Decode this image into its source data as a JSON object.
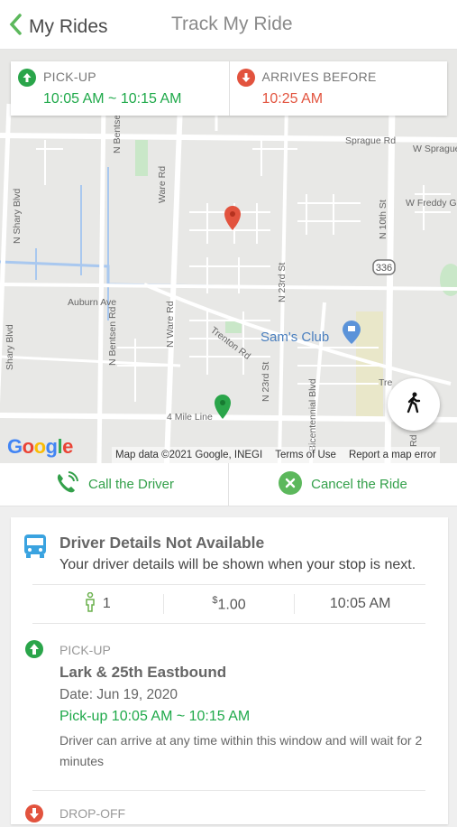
{
  "header": {
    "back_label": "My Rides",
    "title": "Track My Ride"
  },
  "map": {
    "pickup_label": "PICK-UP",
    "pickup_time": "10:05 AM ~ 10:15 AM",
    "arrives_label": "ARRIVES BEFORE",
    "arrives_time": "10:25 AM",
    "google": "Google",
    "attribution": {
      "map_data": "Map data ©2021 Google, INEGI",
      "terms": "Terms of Use",
      "report": "Report a map error"
    },
    "labels": {
      "sprague_rd": "Sprague Rd",
      "w_sprague": "W Sprague",
      "w_freddy": "W Freddy Go",
      "auburn": "Auburn Ave",
      "n_shary": "N Shary Blvd",
      "n_bentsen": "N Bentsen Rd",
      "ware_rd": "Ware Rd",
      "n_ware": "N Ware Rd",
      "trenton": "Trenton Rd",
      "n_23rd": "N 23rd St",
      "n_10th": "N 10th St",
      "four_mile": "4 Mile Line",
      "bicentennial": "Bicentennial Blvd",
      "sams_club": "Sam's Club",
      "hwy336": "336",
      "shary_blvd": "Shary Blvd",
      "tre": "Tre",
      "rd": "Rd"
    }
  },
  "actions": {
    "call": "Call the Driver",
    "cancel": "Cancel the Ride"
  },
  "driver": {
    "title": "Driver Details Not Available",
    "subtitle": "Your driver details will be shown when your stop is next.",
    "passengers": "1",
    "price_symbol": "$",
    "price": "1.00",
    "time": "10:05 AM"
  },
  "pickup": {
    "label": "PICK-UP",
    "stop": "Lark & 25th Eastbound",
    "date": "Date: Jun 19, 2020",
    "window": "Pick-up 10:05 AM ~ 10:15 AM",
    "note": "Driver can arrive at any time within this window and will wait for 2 minutes"
  },
  "dropoff": {
    "label": "DROP-OFF"
  },
  "colors": {
    "accent_green": "#1fa94a",
    "accent_red": "#e2533e",
    "icon_blue": "#3aa3e0"
  }
}
